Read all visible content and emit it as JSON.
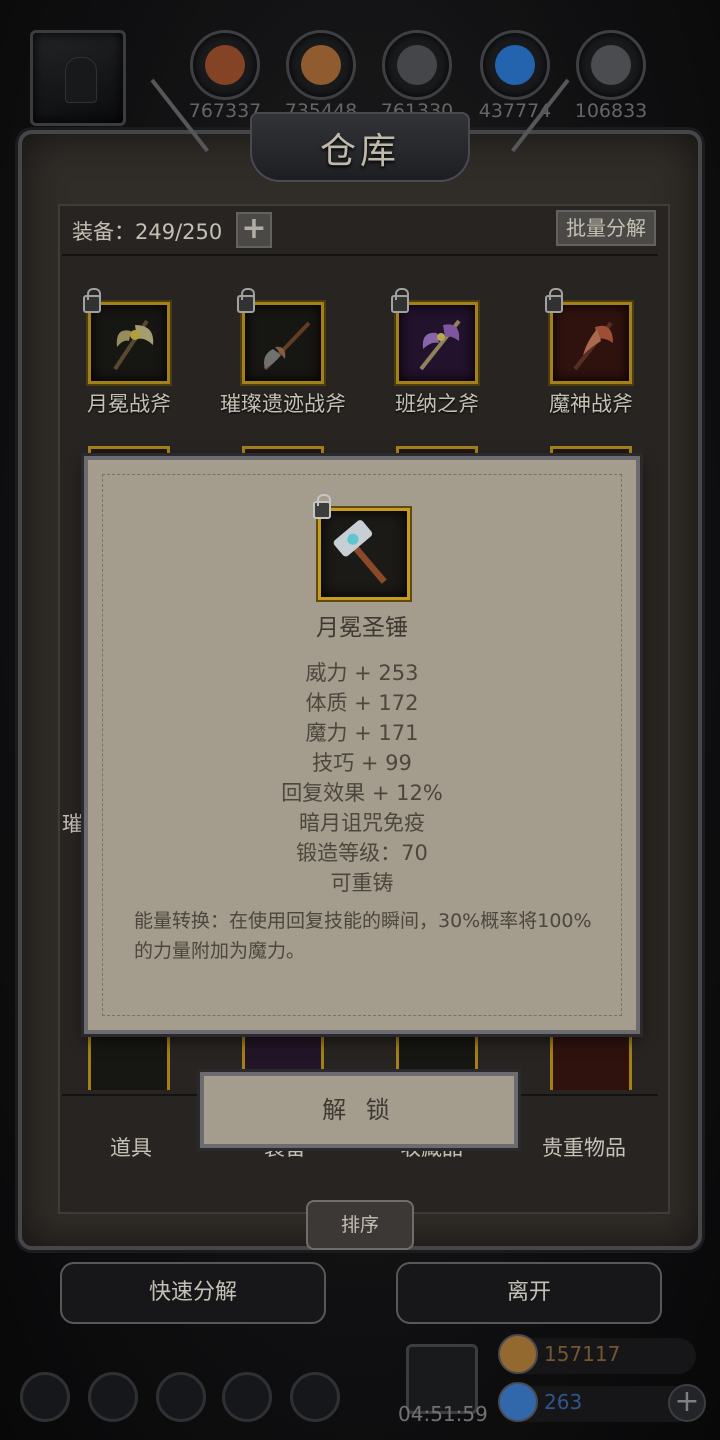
{
  "header": {
    "title": "仓库",
    "resources": [
      {
        "icon": "wood-log-icon",
        "value": "767337",
        "color": "#a0522d"
      },
      {
        "icon": "plank-icon",
        "value": "735448",
        "color": "#b0713a"
      },
      {
        "icon": "iron-ingot-icon",
        "value": "761330",
        "color": "#55565a"
      },
      {
        "icon": "crystal-icon",
        "value": "437774",
        "color": "#2c7bd6"
      },
      {
        "icon": "stone-icon",
        "value": "106833",
        "color": "#5c5d61"
      }
    ]
  },
  "inventory": {
    "equip_count": "装备：249/250",
    "batch_decompose": "批量分解",
    "add": "+",
    "row1": [
      {
        "name": "月冕战斧"
      },
      {
        "name": "璀璨遗迹战斧"
      },
      {
        "name": "班纳之斧"
      },
      {
        "name": "魔神战斧"
      }
    ],
    "partial_label": "璀"
  },
  "popup": {
    "item_name": "月冕圣锤",
    "stats": [
      "威力 + 253",
      "体质 + 172",
      "魔力 + 171",
      "技巧 + 99",
      "回复效果 + 12%",
      "暗月诅咒免疫",
      "锻造等级：70",
      "可重铸"
    ],
    "description": "能量转换：在使用回复技能的瞬间，30%概率将100%的力量附加为魔力。",
    "unlock_button": "解 锁"
  },
  "tabs": [
    {
      "label": "道具"
    },
    {
      "label": "装备"
    },
    {
      "label": "收藏品"
    },
    {
      "label": "贵重物品"
    }
  ],
  "buttons": {
    "sort": "排序",
    "quick_decompose": "快速分解",
    "leave": "离开"
  },
  "footer": {
    "timer": "04:51:59",
    "currency1": {
      "value": "157117",
      "color": "#b5813a"
    },
    "currency2": {
      "value": "263",
      "color": "#3b7fd1"
    },
    "add": "+"
  }
}
